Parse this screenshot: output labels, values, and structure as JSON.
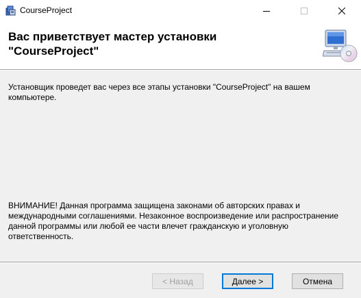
{
  "window": {
    "title": "CourseProject"
  },
  "icons": {
    "app": "installer-icon",
    "banner": "computer-cd-icon",
    "minimize": "minimize-icon",
    "maximize": "maximize-icon",
    "close": "close-icon"
  },
  "header": {
    "title_line1": "Вас приветствует мастер установки",
    "title_line2": "\"CourseProject\""
  },
  "body": {
    "intro_text": "Установщик проведет вас через все этапы установки \"CourseProject\" на вашем компьютере.",
    "warning_text": "ВНИМАНИЕ! Данная программа защищена законами об авторских правах и международными соглашениями. Незаконное воспроизведение или распространение данной программы или любой ее части влечет гражданскую и уголовную ответственность."
  },
  "buttons": {
    "back_label": "< Назад",
    "back_enabled": false,
    "next_label": "Далее >",
    "cancel_label": "Отмена"
  },
  "colors": {
    "accent": "#0078d7",
    "window_bg": "#f0f0f0",
    "banner_bg": "#ffffff"
  }
}
